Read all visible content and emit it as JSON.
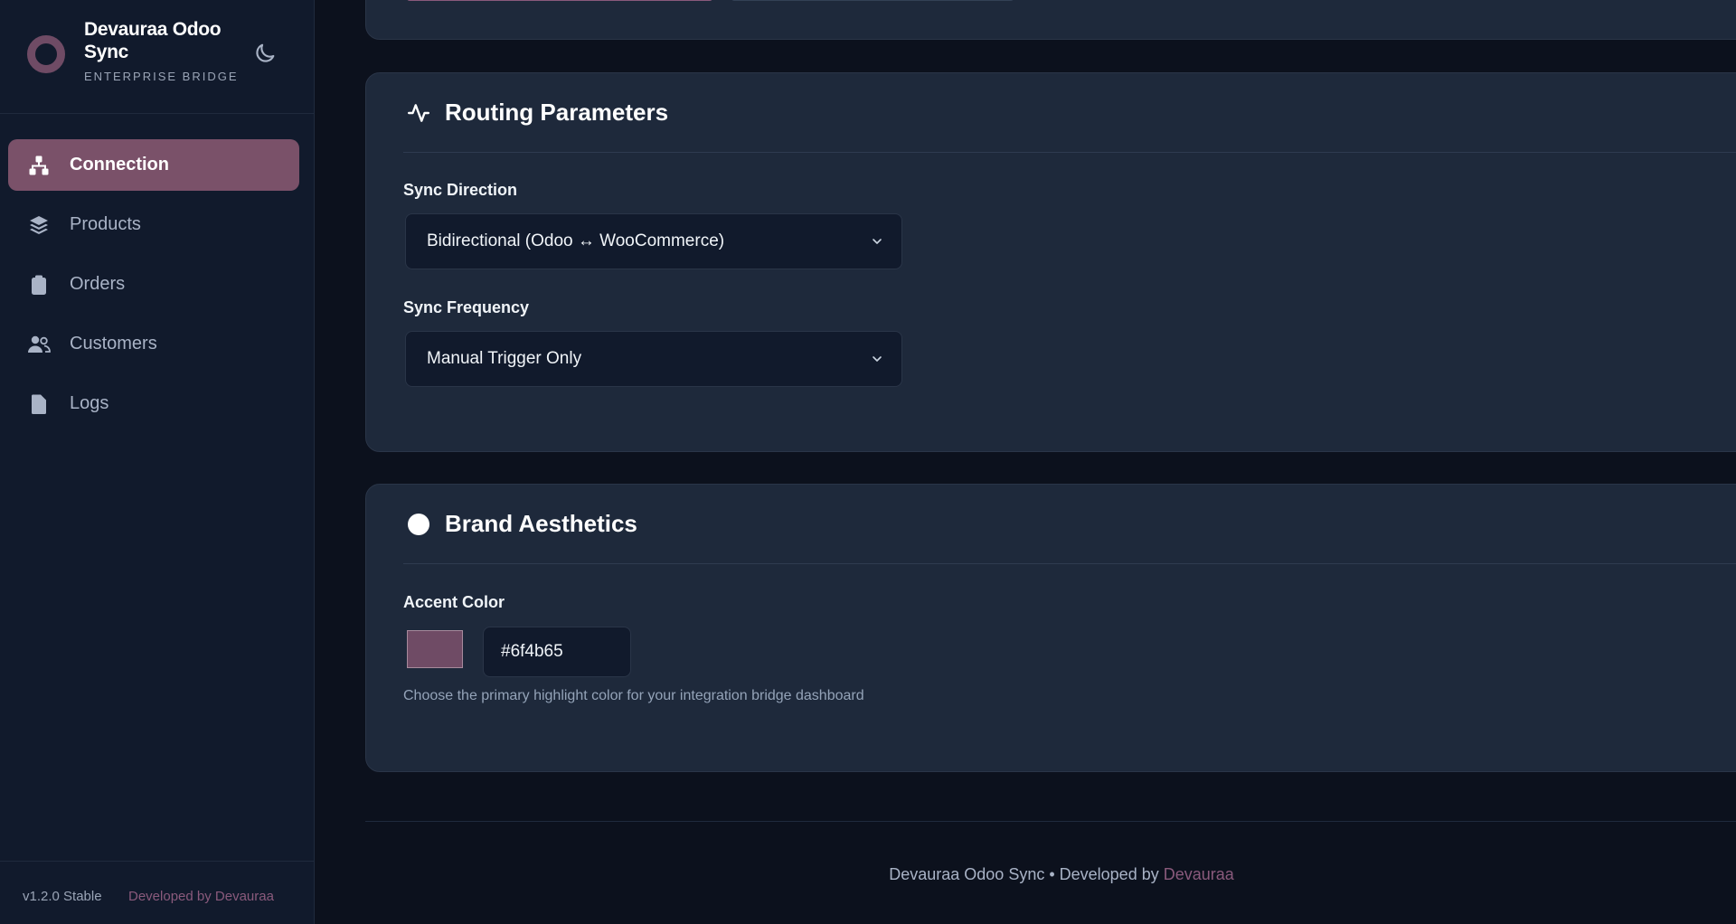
{
  "brand": {
    "title": "Devauraa Odoo Sync",
    "subtitle": "ENTERPRISE BRIDGE",
    "theme_icon": "moon-icon"
  },
  "nav": {
    "items": [
      {
        "label": "Connection",
        "icon": "network-icon",
        "active": true
      },
      {
        "label": "Products",
        "icon": "layers-icon",
        "active": false
      },
      {
        "label": "Orders",
        "icon": "clipboard-icon",
        "active": false
      },
      {
        "label": "Customers",
        "icon": "users-icon",
        "active": false
      },
      {
        "label": "Logs",
        "icon": "file-icon",
        "active": false
      }
    ]
  },
  "sidebar_footer": {
    "version": "v1.2.0 Stable",
    "developed_by": "Developed by Devauraa"
  },
  "routing": {
    "title": "Routing Parameters",
    "icon": "activity-icon",
    "sync_direction": {
      "label": "Sync Direction",
      "value": "Bidirectional (Odoo ↔ WooCommerce)"
    },
    "sync_frequency": {
      "label": "Sync Frequency",
      "value": "Manual Trigger Only"
    }
  },
  "aesthetics": {
    "title": "Brand Aesthetics",
    "icon": "circle-icon",
    "accent_label": "Accent Color",
    "accent_value": "#6f4b65",
    "help": "Choose the primary highlight color for your integration bridge dashboard"
  },
  "footer": {
    "prefix": "Devauraa Odoo Sync • Developed by ",
    "link": "Devauraa"
  },
  "colors": {
    "accent": "#6f4b65",
    "background": "#0c111d",
    "card": "#1e293b",
    "sidebar": "#111a2c"
  }
}
